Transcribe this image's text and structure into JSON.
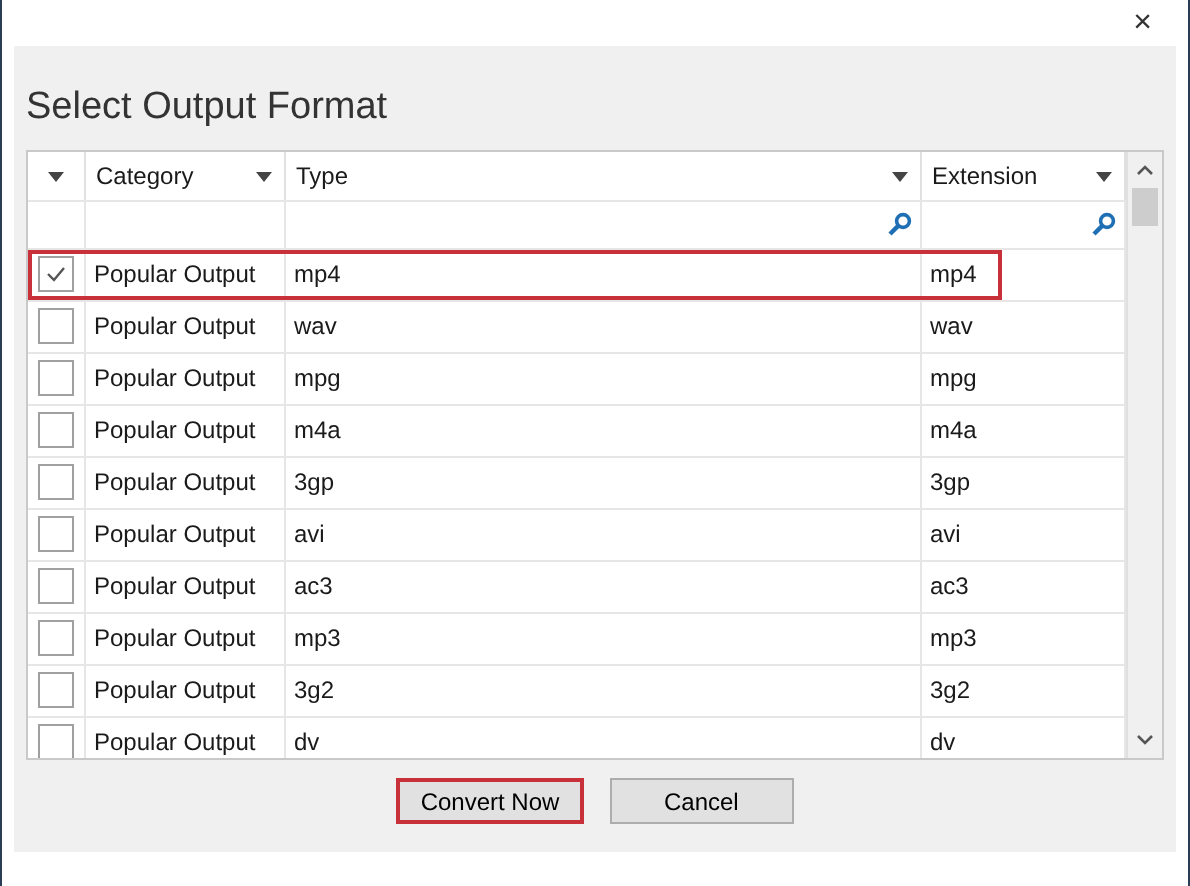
{
  "window": {
    "close": "×",
    "title": "Select Output Format"
  },
  "table": {
    "columns": [
      {
        "label": "Category"
      },
      {
        "label": "Type"
      },
      {
        "label": "Extension"
      }
    ],
    "rows": [
      {
        "checked": true,
        "highlighted": true,
        "category": "Popular Output",
        "type": "mp4",
        "extension": "mp4"
      },
      {
        "checked": false,
        "highlighted": false,
        "category": "Popular Output",
        "type": "wav",
        "extension": "wav"
      },
      {
        "checked": false,
        "highlighted": false,
        "category": "Popular Output",
        "type": "mpg",
        "extension": "mpg"
      },
      {
        "checked": false,
        "highlighted": false,
        "category": "Popular Output",
        "type": "m4a",
        "extension": "m4a"
      },
      {
        "checked": false,
        "highlighted": false,
        "category": "Popular Output",
        "type": "3gp",
        "extension": "3gp"
      },
      {
        "checked": false,
        "highlighted": false,
        "category": "Popular Output",
        "type": "avi",
        "extension": "avi"
      },
      {
        "checked": false,
        "highlighted": false,
        "category": "Popular Output",
        "type": "ac3",
        "extension": "ac3"
      },
      {
        "checked": false,
        "highlighted": false,
        "category": "Popular Output",
        "type": "mp3",
        "extension": "mp3"
      },
      {
        "checked": false,
        "highlighted": false,
        "category": "Popular Output",
        "type": "3g2",
        "extension": "3g2"
      },
      {
        "checked": false,
        "highlighted": false,
        "category": "Popular Output",
        "type": "dv",
        "extension": "dv"
      }
    ]
  },
  "buttons": [
    {
      "label": "Convert Now",
      "highlighted": true
    },
    {
      "label": "Cancel",
      "highlighted": false
    }
  ]
}
